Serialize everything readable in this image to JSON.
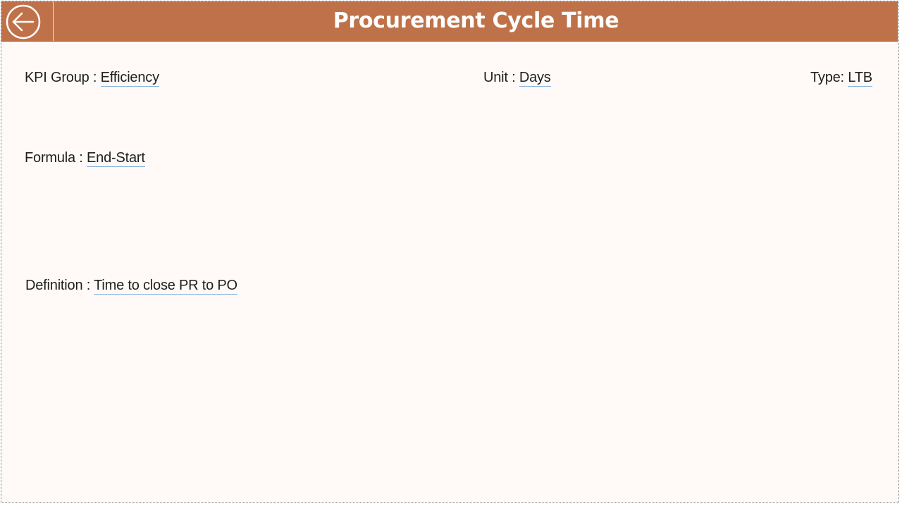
{
  "header": {
    "title": "Procurement Cycle Time",
    "back_icon": "arrow-left-circle-icon",
    "background_color": "#bf7249"
  },
  "fields": {
    "kpi_group": {
      "label": "KPI Group : ",
      "value": "Efficiency"
    },
    "unit": {
      "label": "Unit : ",
      "value": "Days"
    },
    "type": {
      "label": "Type: ",
      "value": "LTB"
    },
    "formula": {
      "label": "Formula : ",
      "value": "End-Start"
    },
    "definition": {
      "label": "Definition : ",
      "value": "Time to close PR to PO"
    }
  }
}
